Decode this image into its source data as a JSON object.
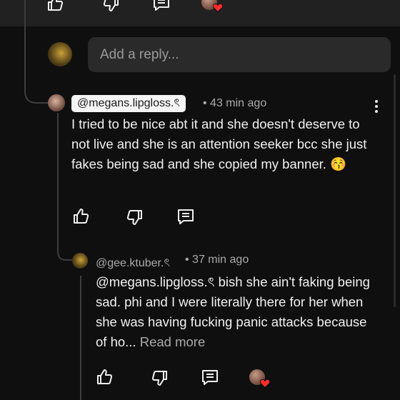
{
  "top_actions": {
    "like_icon": "thumbs-up-icon",
    "dislike_icon": "thumbs-down-icon",
    "reply_icon": "comment-icon"
  },
  "reply_input": {
    "placeholder": "Add a reply..."
  },
  "comment": {
    "author": "@megans.lipgloss.ৎ",
    "time": "• 43 min ago",
    "text": "I tried to be nice abt it and she doesn't deserve to not live and she is an attention seeker bcc she just fakes being sad and she copied my banner.",
    "emoji": "😚"
  },
  "reply": {
    "author": "@gee.ktuber.ৎ",
    "time": "• 37 min ago",
    "text": "@megans.lipgloss.ৎ bish she ain't faking being sad. phi and I were literally there for her when she was having fucking panic attacks because of ho...",
    "read_more": "Read more"
  },
  "colors": {
    "background": "#0f0f0f",
    "heart": "#ff2d2d"
  }
}
